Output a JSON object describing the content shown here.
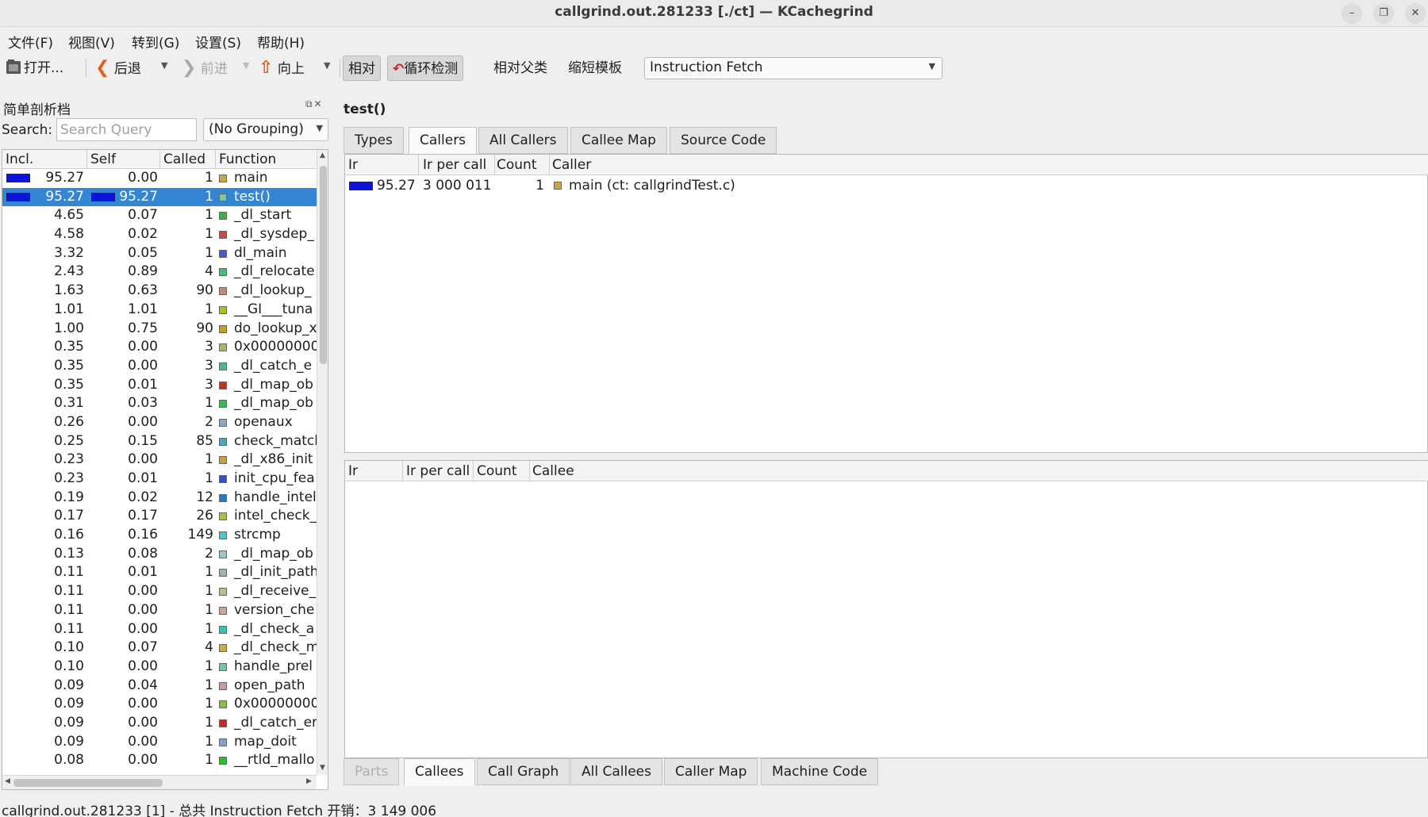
{
  "window": {
    "title": "callgrind.out.281233 [./ct] — KCachegrind",
    "min_glyph": "–",
    "max_glyph": "❐",
    "close_glyph": "✕"
  },
  "menu": [
    "文件(F)",
    "视图(V)",
    "转到(G)",
    "设置(S)",
    "帮助(H)"
  ],
  "toolbar": {
    "open_label": "打开...",
    "back_label": "后退",
    "forward_label": "前进",
    "up_label": "向上",
    "relative_label": "相对",
    "cycle_label": "循环检测",
    "relative_parent_label": "相对父类",
    "shorten_label": "缩短模板",
    "event_type": "Instruction Fetch"
  },
  "flat_profile": {
    "dock_title": "简单剖析档",
    "search_label": "Search:",
    "search_placeholder": "Search Query",
    "search_value": "",
    "grouping": "(No Grouping)",
    "columns": [
      "Incl.",
      "Self",
      "Called",
      "Function"
    ],
    "rows": [
      {
        "incl": "95.27",
        "self": "0.00",
        "called": "1",
        "fn": "main",
        "color": "#c8a844",
        "incl_bar": true
      },
      {
        "incl": "95.27",
        "self": "95.27",
        "called": "1",
        "fn": "test()",
        "color": "#7ac9a9",
        "incl_bar": true,
        "self_bar": true,
        "selected": true
      },
      {
        "incl": "4.65",
        "self": "0.07",
        "called": "1",
        "fn": "_dl_start",
        "color": "#40b040"
      },
      {
        "incl": "4.58",
        "self": "0.02",
        "called": "1",
        "fn": "_dl_sysdep_",
        "color": "#c84848"
      },
      {
        "incl": "3.32",
        "self": "0.05",
        "called": "1",
        "fn": "dl_main",
        "color": "#4858c8"
      },
      {
        "incl": "2.43",
        "self": "0.89",
        "called": "4",
        "fn": "_dl_relocate",
        "color": "#40c070"
      },
      {
        "incl": "1.63",
        "self": "0.63",
        "called": "90",
        "fn": "_dl_lookup_",
        "color": "#c88878"
      },
      {
        "incl": "1.01",
        "self": "1.01",
        "called": "1",
        "fn": "__GI___tuna",
        "color": "#a8c020"
      },
      {
        "incl": "1.00",
        "self": "0.75",
        "called": "90",
        "fn": "do_lookup_x",
        "color": "#c8a020"
      },
      {
        "incl": "0.35",
        "self": "0.00",
        "called": "3",
        "fn": "0x00000000",
        "color": "#a8b868"
      },
      {
        "incl": "0.35",
        "self": "0.00",
        "called": "3",
        "fn": "_dl_catch_e",
        "color": "#48b898"
      },
      {
        "incl": "0.35",
        "self": "0.01",
        "called": "3",
        "fn": "_dl_map_ob",
        "color": "#c83020"
      },
      {
        "incl": "0.31",
        "self": "0.03",
        "called": "1",
        "fn": "_dl_map_ob",
        "color": "#30c050"
      },
      {
        "incl": "0.26",
        "self": "0.00",
        "called": "2",
        "fn": "openaux",
        "color": "#88a8c8"
      },
      {
        "incl": "0.25",
        "self": "0.15",
        "called": "85",
        "fn": "check_match",
        "color": "#48a8c8"
      },
      {
        "incl": "0.23",
        "self": "0.00",
        "called": "1",
        "fn": "_dl_x86_init",
        "color": "#c8a040"
      },
      {
        "incl": "0.23",
        "self": "0.01",
        "called": "1",
        "fn": "init_cpu_fea",
        "color": "#3050c8"
      },
      {
        "incl": "0.19",
        "self": "0.02",
        "called": "12",
        "fn": "handle_intel",
        "color": "#2878c8"
      },
      {
        "incl": "0.17",
        "self": "0.17",
        "called": "26",
        "fn": "intel_check_",
        "color": "#a8c048"
      },
      {
        "incl": "0.16",
        "self": "0.16",
        "called": "149",
        "fn": "strcmp",
        "color": "#48c8c8"
      },
      {
        "incl": "0.13",
        "self": "0.08",
        "called": "2",
        "fn": "_dl_map_ob",
        "color": "#98c8c8"
      },
      {
        "incl": "0.11",
        "self": "0.01",
        "called": "1",
        "fn": "_dl_init_path",
        "color": "#98b8b8"
      },
      {
        "incl": "0.11",
        "self": "0.00",
        "called": "1",
        "fn": "_dl_receive_",
        "color": "#b8c088"
      },
      {
        "incl": "0.11",
        "self": "0.00",
        "called": "1",
        "fn": "version_che",
        "color": "#c8a898"
      },
      {
        "incl": "0.11",
        "self": "0.00",
        "called": "1",
        "fn": "_dl_check_a",
        "color": "#30c8a8"
      },
      {
        "incl": "0.10",
        "self": "0.07",
        "called": "4",
        "fn": "_dl_check_m",
        "color": "#c8b040"
      },
      {
        "incl": "0.10",
        "self": "0.00",
        "called": "1",
        "fn": "handle_prel",
        "color": "#78c0b0"
      },
      {
        "incl": "0.09",
        "self": "0.04",
        "called": "1",
        "fn": "open_path",
        "color": "#c8a098"
      },
      {
        "incl": "0.09",
        "self": "0.00",
        "called": "1",
        "fn": "0x00000000",
        "color": "#88c040"
      },
      {
        "incl": "0.09",
        "self": "0.00",
        "called": "1",
        "fn": "_dl_catch_er",
        "color": "#c82828"
      },
      {
        "incl": "0.09",
        "self": "0.00",
        "called": "1",
        "fn": "map_doit",
        "color": "#88a0c8"
      },
      {
        "incl": "0.08",
        "self": "0.00",
        "called": "1",
        "fn": "__rtld_mallo",
        "color": "#28c028"
      }
    ]
  },
  "detail": {
    "function_title": "test()",
    "top_tabs": [
      {
        "label": "Types"
      },
      {
        "label": "Callers",
        "active": true
      },
      {
        "label": "All Callers"
      },
      {
        "label": "Callee Map"
      },
      {
        "label": "Source Code"
      }
    ],
    "callers_columns": [
      "Ir",
      "Ir per call",
      "Count",
      "Caller"
    ],
    "callers_rows": [
      {
        "ir": "95.27",
        "ir_per_call": "3 000 011",
        "count": "1",
        "caller": "main (ct: callgrindTest.c)",
        "color": "#c8a844"
      }
    ],
    "callees_columns": [
      "Ir",
      "Ir per call",
      "Count",
      "Callee"
    ],
    "bottom_tabs": [
      {
        "label": "Parts",
        "disabled": true
      },
      {
        "label": "Callees",
        "active": true
      },
      {
        "label": "Call Graph"
      },
      {
        "label": "All Callees"
      },
      {
        "label": "Caller Map"
      },
      {
        "label": "Machine Code"
      }
    ]
  },
  "statusbar": "callgrind.out.281233 [1] - 总共 Instruction Fetch 开销：3 149 006",
  "colors": {
    "bar": "#0d14d9",
    "selection": "#3485d3"
  }
}
